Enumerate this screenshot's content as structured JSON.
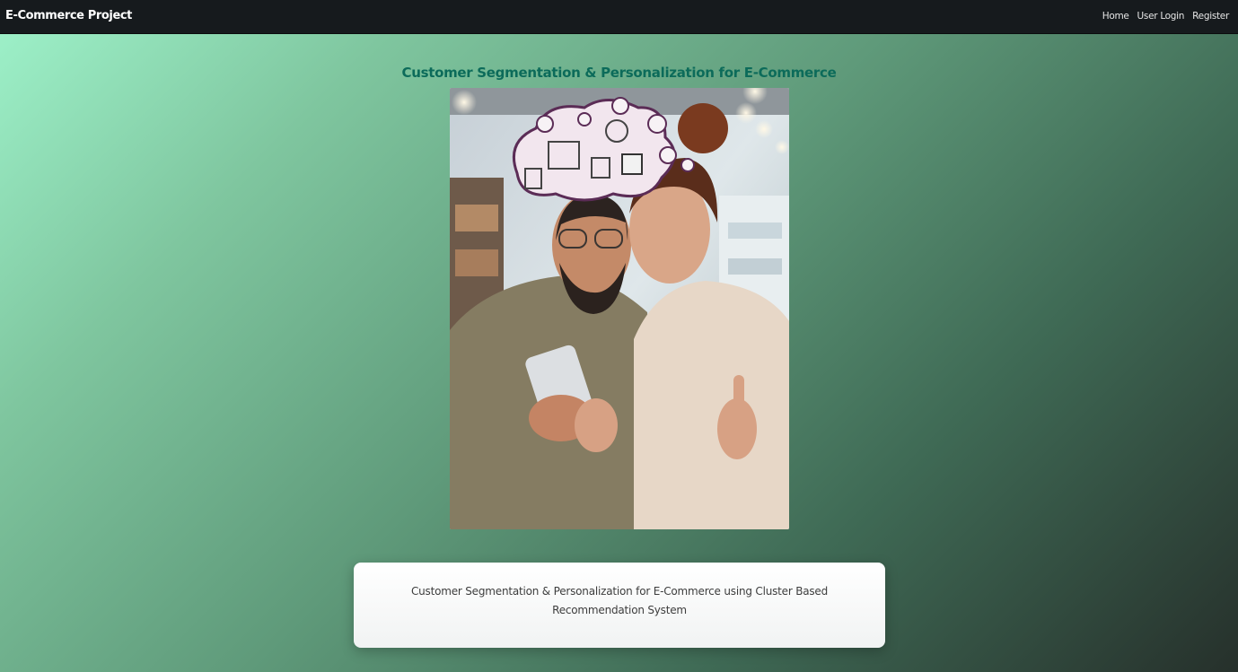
{
  "navbar": {
    "brand": "E-Commerce Project",
    "links": [
      "Home",
      "User Login",
      "Register"
    ]
  },
  "main": {
    "title": "Customer Segmentation & Personalization for E-Commerce",
    "caption": "Customer Segmentation & Personalization for E-Commerce using Cluster Based Recommendation System"
  },
  "colors": {
    "navbar_bg": "#161a1d",
    "title": "#0c6b5a",
    "gradient_start": "#9ff3cb",
    "gradient_end": "#26302b"
  }
}
